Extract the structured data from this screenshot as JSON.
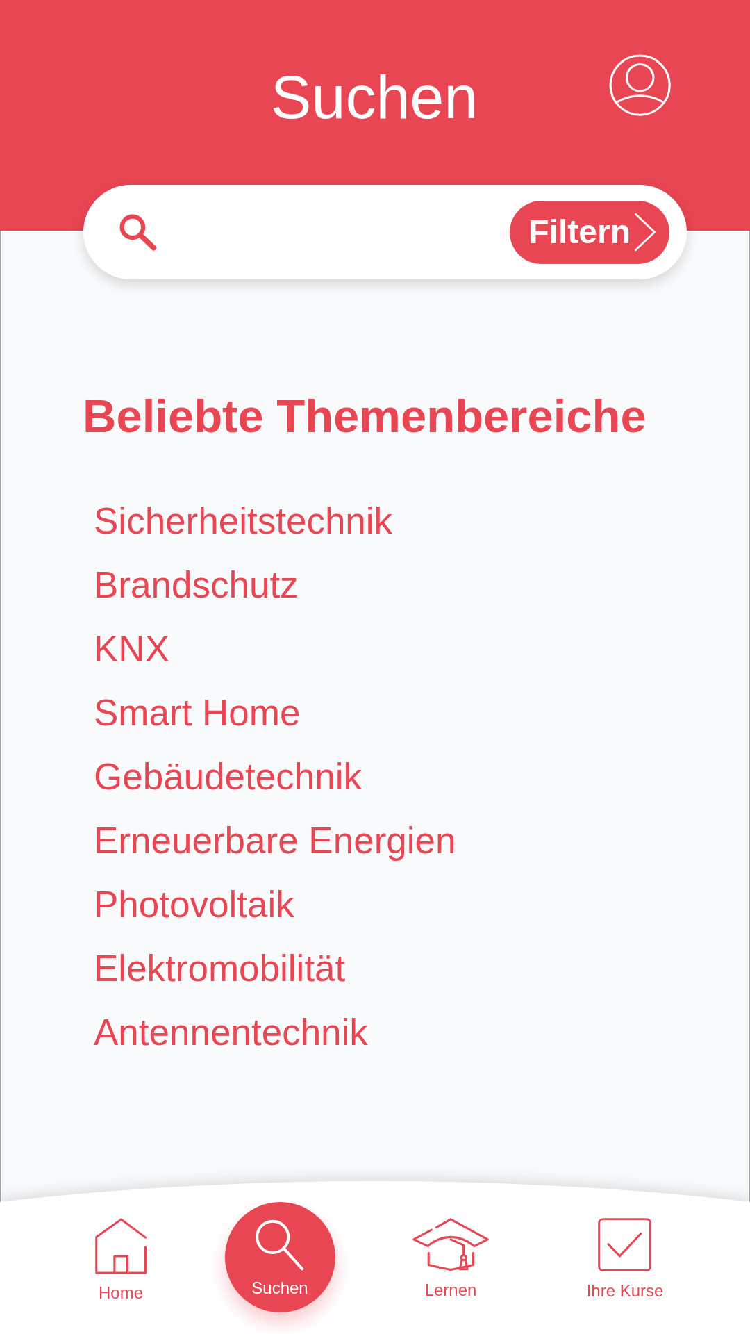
{
  "header": {
    "title": "Suchen"
  },
  "search": {
    "filter_button": "Filtern"
  },
  "topics_section": {
    "heading": "Beliebte Themenbereiche",
    "topics": [
      "Sicherheitstechnik",
      "Brandschutz",
      "KNX",
      "Smart Home",
      "Gebäudetechnik",
      "Erneuerbare Energien",
      "Photovoltaik",
      "Elektromobilität",
      "Antennentechnik"
    ]
  },
  "bottom_nav": [
    {
      "label": "Home",
      "selected": false
    },
    {
      "label": "Suchen",
      "selected": true
    },
    {
      "label": "Lernen",
      "selected": false
    },
    {
      "label": "Ihre Kurse",
      "selected": false
    }
  ]
}
